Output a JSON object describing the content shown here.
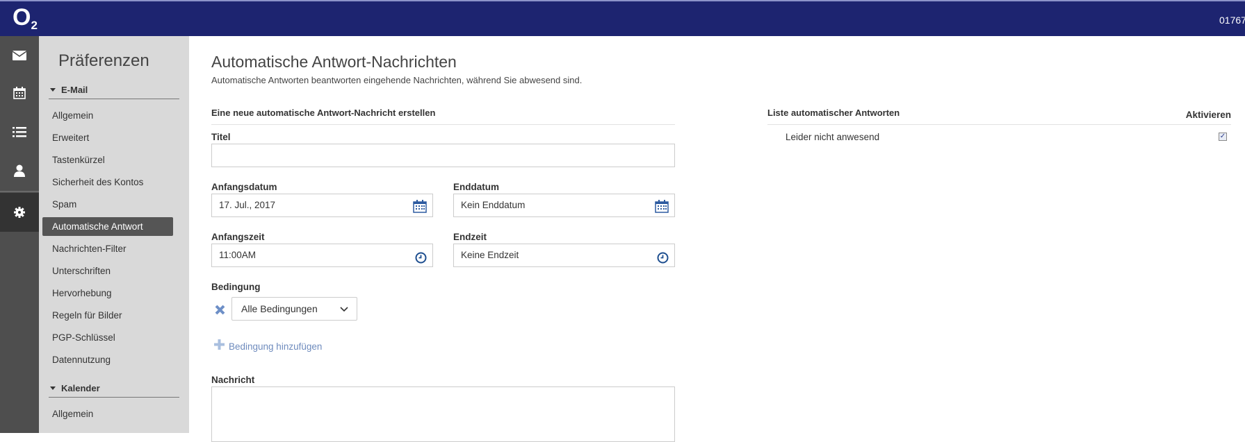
{
  "header": {
    "logo": "O",
    "logo_sub": "2",
    "phone": "01767"
  },
  "rail": [
    "mail-icon",
    "calendar-icon",
    "list-icon",
    "user-icon",
    "gear-icon"
  ],
  "prefs": {
    "title": "Präferenzen",
    "email_section": "E-Mail",
    "email_items": [
      "Allgemein",
      "Erweitert",
      "Tastenkürzel",
      "Sicherheit des Kontos",
      "Spam",
      "Automatische Antwort",
      "Nachrichten-Filter",
      "Unterschriften",
      "Hervorhebung",
      "Regeln für Bilder",
      "PGP-Schlüssel",
      "Datennutzung"
    ],
    "calendar_section": "Kalender",
    "calendar_items": [
      "Allgemein"
    ]
  },
  "main": {
    "title": "Automatische Antwort-Nachrichten",
    "subtitle": "Automatische Antworten beantworten eingehende Nachrichten, während Sie abwesend sind.",
    "create_heading": "Eine neue automatische Antwort-Nachricht erstellen",
    "titel_label": "Titel",
    "titel_value": "",
    "start_date_label": "Anfangsdatum",
    "start_date_value": "17. Jul., 2017",
    "end_date_label": "Enddatum",
    "end_date_value": "Kein Enddatum",
    "start_time_label": "Anfangszeit",
    "start_time_value": "11:00AM",
    "end_time_label": "Endzeit",
    "end_time_value": "Keine Endzeit",
    "condition_label": "Bedingung",
    "condition_value": "Alle Bedingungen",
    "add_condition": "Bedingung hinzufügen",
    "message_label": "Nachricht",
    "message_value": ""
  },
  "list": {
    "heading": "Liste automatischer Antworten",
    "activate_heading": "Aktivieren",
    "rows": [
      {
        "name": "Leider nicht anwesend",
        "active": true
      }
    ]
  }
}
